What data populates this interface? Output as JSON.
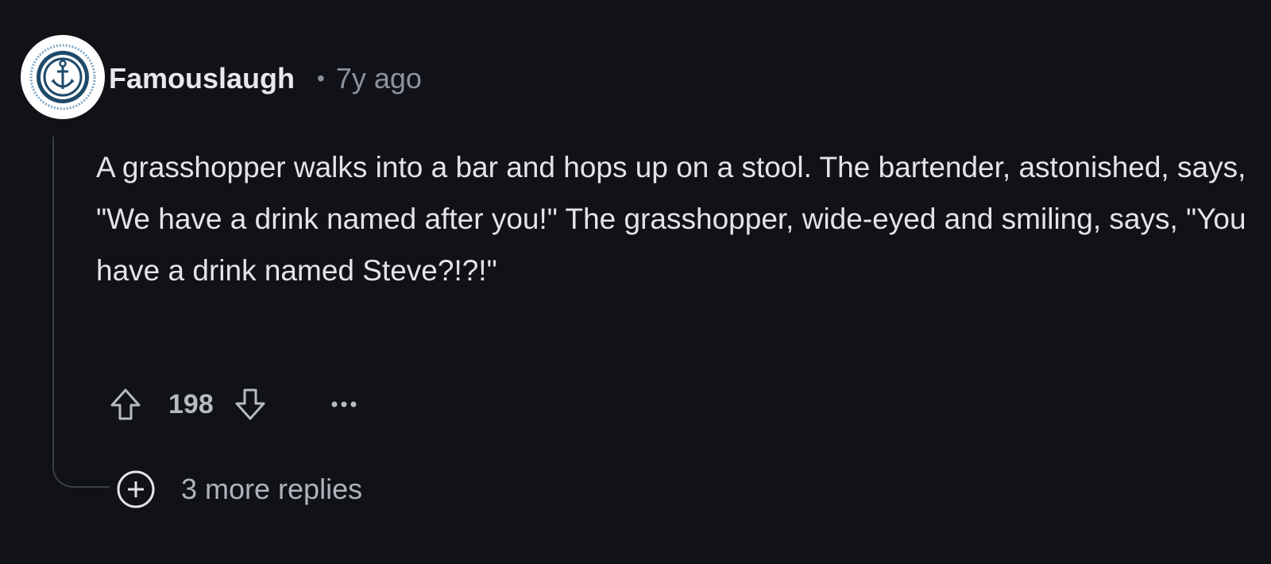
{
  "comment": {
    "username": "Famouslaugh",
    "separator": "•",
    "timestamp": "7y ago",
    "body": "A grasshopper walks into a bar and hops up on a stool. The bartender, astonished, says, \"We have a drink named after you!\" The grasshopper, wide-eyed and smiling, says, \"You have a drink named Steve?!?!\"",
    "score": "198",
    "more_replies": "3 more replies"
  },
  "icons": {
    "avatar": "anchor-icon",
    "upvote": "arrow-up-icon",
    "downvote": "arrow-down-icon",
    "more": "ellipsis-icon",
    "expand": "plus-circle-icon"
  },
  "colors": {
    "background": "#101217",
    "text": "#e3e4e6",
    "muted": "#8c939e",
    "avatar_badge": "#1e4a6a"
  }
}
